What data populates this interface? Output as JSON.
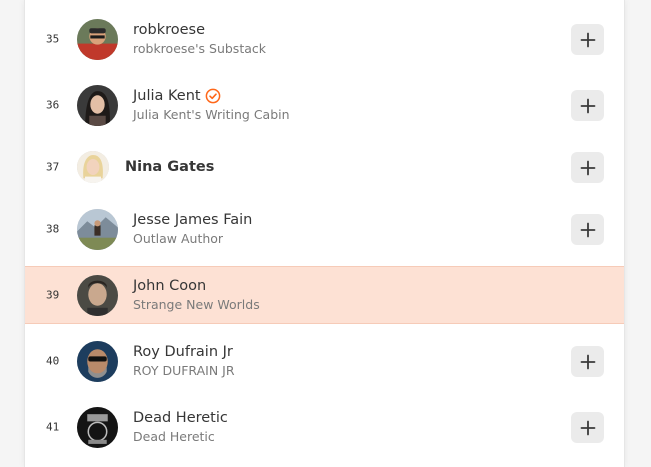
{
  "leaderboard": {
    "rows": [
      {
        "rank": "35",
        "name": "robkroese",
        "subtitle": "robkroese's Substack",
        "verified": false,
        "avatar_icon": "person-photo-red",
        "highlighted": false,
        "has_add_button": true
      },
      {
        "rank": "36",
        "name": "Julia Kent",
        "subtitle": "Julia Kent's Writing Cabin",
        "verified": true,
        "avatar_icon": "woman-portrait-dark",
        "highlighted": false,
        "has_add_button": true
      },
      {
        "rank": "37",
        "name": "Nina Gates",
        "subtitle": "",
        "verified": false,
        "avatar_icon": "woman-portrait-light",
        "highlighted": false,
        "has_add_button": true
      },
      {
        "rank": "38",
        "name": "Jesse James Fain",
        "subtitle": "Outlaw Author",
        "verified": false,
        "avatar_icon": "rider-landscape",
        "highlighted": false,
        "has_add_button": true
      },
      {
        "rank": "39",
        "name": "John Coon",
        "subtitle": "Strange New Worlds",
        "verified": false,
        "avatar_icon": "man-portrait",
        "highlighted": true,
        "has_add_button": false
      },
      {
        "rank": "40",
        "name": "Roy Dufrain Jr",
        "subtitle": "ROY DUFRAIN JR",
        "verified": false,
        "avatar_icon": "man-sunglasses",
        "highlighted": false,
        "has_add_button": true
      },
      {
        "rank": "41",
        "name": "Dead Heretic",
        "subtitle": "Dead Heretic",
        "verified": false,
        "avatar_icon": "dark-emblem",
        "highlighted": false,
        "has_add_button": true
      }
    ],
    "add_button_icon": "plus-icon",
    "verified_icon": "verified-check-icon"
  },
  "colors": {
    "highlight_background": "#fde1d4",
    "verified_accent": "#ff6719",
    "add_button_background": "#ebebeb"
  }
}
